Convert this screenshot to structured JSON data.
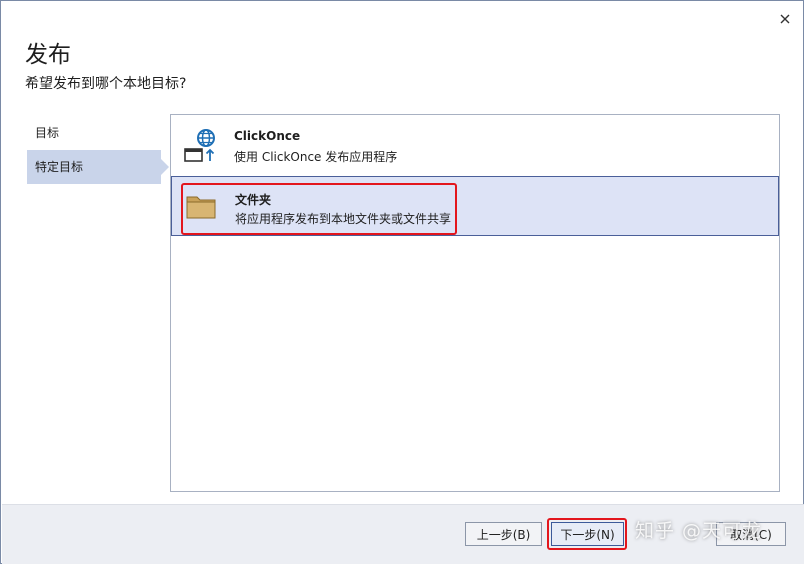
{
  "dialog": {
    "title": "发布",
    "subtitle": "希望发布到哪个本地目标?"
  },
  "nav": {
    "items": [
      {
        "label": "目标"
      },
      {
        "label": "特定目标"
      }
    ]
  },
  "options": [
    {
      "title": "ClickOnce",
      "description": "使用 ClickOnce 发布应用程序",
      "icon": "clickonce-globe-icon"
    },
    {
      "title": "文件夹",
      "description": "将应用程序发布到本地文件夹或文件共享",
      "icon": "folder-icon"
    }
  ],
  "buttons": {
    "back": "上一步(B)",
    "next": "下一步(N)",
    "cancel": "取消(C)"
  },
  "watermark": "知乎 @天可龙",
  "colors": {
    "selection": "#dde3f6",
    "highlight": "#e3161d",
    "globe": "#1f6fb5",
    "folder": "#c9a25a"
  }
}
